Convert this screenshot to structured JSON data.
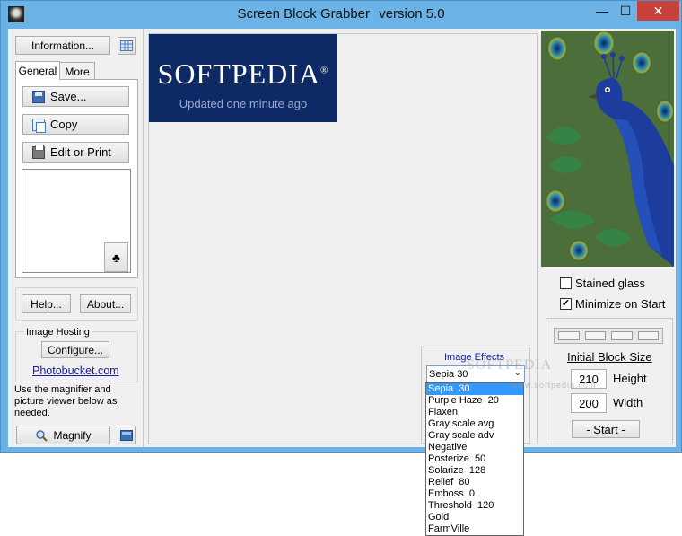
{
  "window": {
    "title_app": "Screen Block Grabber",
    "title_version": "version 5.0",
    "minimize_glyph": "—",
    "maximize_glyph": "☐",
    "close_glyph": "✕"
  },
  "left": {
    "information_label": "Information...",
    "tabs": [
      {
        "label": "General",
        "active": true
      },
      {
        "label": "More",
        "active": false
      }
    ],
    "save_label": "Save...",
    "copy_label": "Copy",
    "edit_print_label": "Edit or Print",
    "club_glyph": "♣",
    "help_label": "Help...",
    "about_label": "About...",
    "image_hosting_label": "Image Hosting",
    "configure_label": "Configure...",
    "photobucket_link": "Photobucket.com",
    "magnifier_hint": "Use the magnifier and picture viewer below as needed.",
    "magnify_label": "Magnify"
  },
  "canvas": {
    "banner_logo": "SOFTPEDIA",
    "banner_reg": "®",
    "banner_sub": "Updated one minute ago"
  },
  "effects": {
    "label": "Image Effects",
    "selected": "Sepia  30",
    "options": [
      "Sepia  30",
      "Purple Haze  20",
      "Flaxen",
      "Gray scale avg",
      "Gray scale adv",
      "Negative",
      "Posterize  50",
      "Solarize  128",
      "Relief  80",
      "Emboss  0",
      "Threshold  120",
      "Gold",
      "FarmVille"
    ],
    "watermark": "SOFTPEDIA",
    "watermark_url": "www.softpedia.com"
  },
  "right": {
    "stained_glass_label": "Stained glass",
    "stained_glass_checked": false,
    "minimize_label": "Minimize on Start",
    "minimize_checked": true,
    "check_glyph": "✔",
    "initial_block_label": "Initial Block Size",
    "height_value": "210",
    "height_label": "Height",
    "width_value": "200",
    "width_label": "Width",
    "start_label": "- Start -"
  },
  "colors": {
    "title_bar": "#6bb2e6",
    "close_button": "#c7403a",
    "banner_bg": "#0e2a66",
    "dropdown_selection": "#3399ff",
    "link": "#1a1a9e"
  }
}
